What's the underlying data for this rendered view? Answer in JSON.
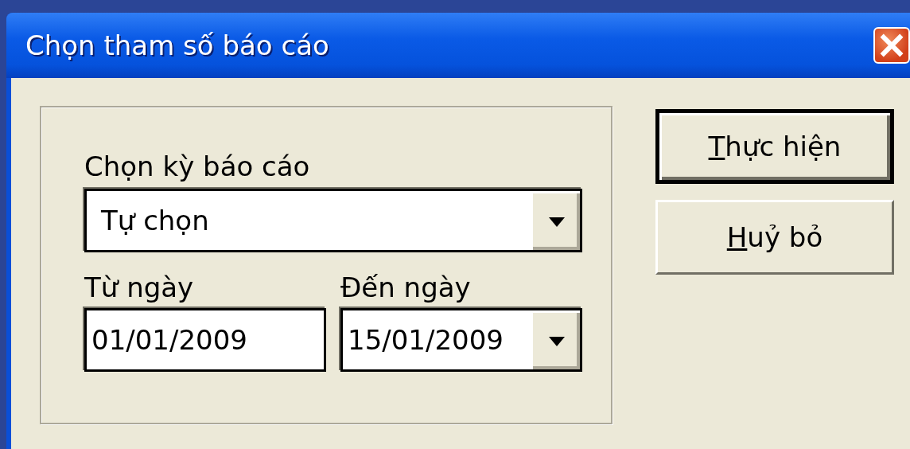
{
  "window": {
    "title": "Chọn tham số báo cáo"
  },
  "period": {
    "label": "Chọn kỳ báo cáo",
    "value": "Tự chọn"
  },
  "from_date": {
    "label": "Từ ngày",
    "value": "01/01/2009"
  },
  "to_date": {
    "label": "Đến ngày",
    "value": "15/01/2009"
  },
  "buttons": [
    {
      "label": "Thực hiện",
      "default": true
    },
    {
      "label": "Huỷ bỏ",
      "default": false
    }
  ]
}
